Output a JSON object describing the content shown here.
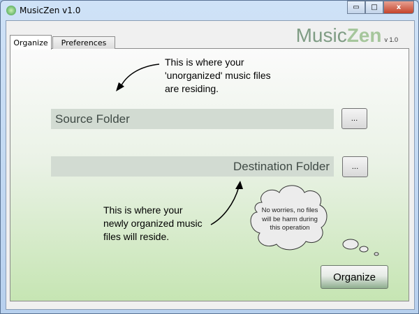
{
  "window": {
    "title": "MusicZen v1.0",
    "minimize": "▭",
    "maximize": "□",
    "close": "x"
  },
  "logo": {
    "music": "Music",
    "zen": "Zen",
    "version": "v 1.0"
  },
  "tabs": [
    {
      "label": "Organize"
    },
    {
      "label": "Preferences"
    }
  ],
  "notes": {
    "source_hint": "This is where your 'unorganized' music files are residing.",
    "destination_hint": "This is where your newly organized music files will reside.",
    "cloud": "No worries, no files will be harm during this operation"
  },
  "source": {
    "placeholder": "Source Folder",
    "browse": "..."
  },
  "destination": {
    "placeholder": "Destination Folder",
    "browse": "..."
  },
  "organize_button": "Organize"
}
